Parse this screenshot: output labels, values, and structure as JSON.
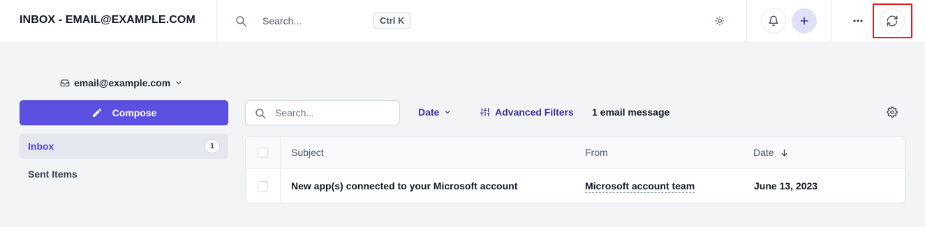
{
  "header": {
    "title": "INBOX - EMAIL@EXAMPLE.COM",
    "search_placeholder": "Search...",
    "shortcut": "Ctrl K",
    "icons": [
      "search-icon",
      "sun-icon",
      "bell-icon",
      "plus-icon",
      "more-dots-icon",
      "refresh-icon"
    ]
  },
  "sidebar": {
    "account": "email@example.com",
    "compose_label": "Compose",
    "items": [
      {
        "label": "Inbox",
        "count": "1"
      },
      {
        "label": "Sent Items"
      }
    ]
  },
  "toolbar": {
    "search_placeholder": "Search...",
    "date_label": "Date",
    "advanced_filters_label": "Advanced Filters",
    "message_count": "1 email message"
  },
  "table": {
    "columns": [
      "Subject",
      "From",
      "Date"
    ],
    "rows": [
      {
        "subject": "New app(s) connected to your Microsoft account",
        "from": "Microsoft account team",
        "date": "June 13, 2023"
      }
    ]
  },
  "colors": {
    "accent": "#5b50e0",
    "highlight": "#e11d1d"
  }
}
